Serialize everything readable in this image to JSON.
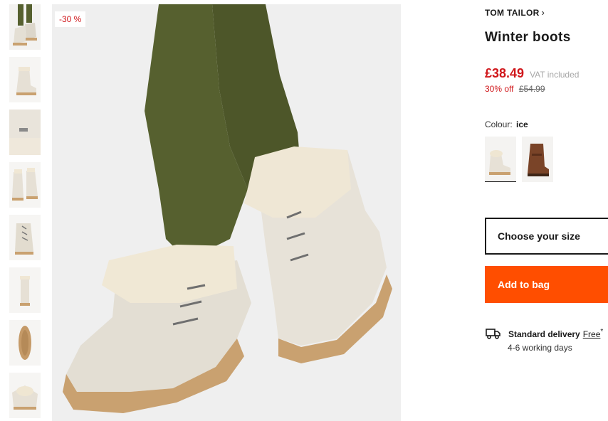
{
  "thumbnails": [
    {
      "icon": "boots-pair-worn-thumb"
    },
    {
      "icon": "boot-side-thumb"
    },
    {
      "icon": "boot-detail-thumb"
    },
    {
      "icon": "boots-front-thumb"
    },
    {
      "icon": "boot-laces-thumb"
    },
    {
      "icon": "boot-back-thumb"
    },
    {
      "icon": "boot-sole-thumb"
    },
    {
      "icon": "boot-top-thumb"
    }
  ],
  "main_image": {
    "badge": "-30 %"
  },
  "product": {
    "brand": "TOM TAILOR",
    "brand_chevron": "›",
    "title": "Winter boots",
    "price": "£38.49",
    "vat": "VAT included",
    "discount": "30% off",
    "original_price": "£54.99"
  },
  "colour": {
    "label": "Colour:",
    "value": "ice",
    "swatches": [
      {
        "name": "ice",
        "hex": "#e7e1d6"
      },
      {
        "name": "brown",
        "hex": "#7a4428"
      }
    ]
  },
  "size": {
    "label": "Choose your size"
  },
  "cart": {
    "label": "Add to bag",
    "color": "#ff4e00"
  },
  "delivery": {
    "label": "Standard delivery",
    "free": "Free",
    "asterisk": "*",
    "time": "4-6 working days"
  },
  "colors": {
    "sale_red": "#d0171b",
    "accent_orange": "#ff4e00"
  }
}
